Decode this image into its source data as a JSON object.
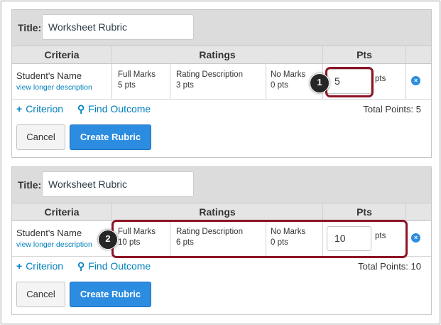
{
  "rubrics": [
    {
      "title_label": "Title:",
      "title_value": "Worksheet Rubric",
      "headers": {
        "criteria": "Criteria",
        "ratings": "Ratings",
        "pts": "Pts"
      },
      "criterion": {
        "name": "Student's Name",
        "link": "view longer description",
        "ratings": [
          {
            "label": "Full Marks",
            "points": "5 pts"
          },
          {
            "label": "Rating Description",
            "points": "3 pts"
          },
          {
            "label": "No Marks",
            "points": "0 pts"
          }
        ],
        "points_value": "5",
        "points_unit": "pts",
        "delete_glyph": "×"
      },
      "actions": {
        "criterion_icon": "+",
        "criterion": "Criterion",
        "outcome_icon": "⚲",
        "outcome": "Find Outcome"
      },
      "total": "Total Points: 5",
      "buttons": {
        "cancel": "Cancel",
        "create": "Create Rubric"
      },
      "callout": "1"
    },
    {
      "title_label": "Title:",
      "title_value": "Worksheet Rubric",
      "headers": {
        "criteria": "Criteria",
        "ratings": "Ratings",
        "pts": "Pts"
      },
      "criterion": {
        "name": "Student's Name",
        "link": "view longer description",
        "ratings": [
          {
            "label": "Full Marks",
            "points": "10 pts"
          },
          {
            "label": "Rating Description",
            "points": "6 pts"
          },
          {
            "label": "No Marks",
            "points": "0 pts"
          }
        ],
        "points_value": "10",
        "points_unit": "pts",
        "delete_glyph": "×"
      },
      "actions": {
        "criterion_icon": "+",
        "criterion": "Criterion",
        "outcome_icon": "⚲",
        "outcome": "Find Outcome"
      },
      "total": "Total Points: 10",
      "buttons": {
        "cancel": "Cancel",
        "create": "Create Rubric"
      },
      "callout": "2"
    }
  ],
  "colors": {
    "link": "#0081bd",
    "primary_button": "#2c8ce0",
    "highlight": "#8c1425",
    "header_bg": "#dcdcdc"
  }
}
